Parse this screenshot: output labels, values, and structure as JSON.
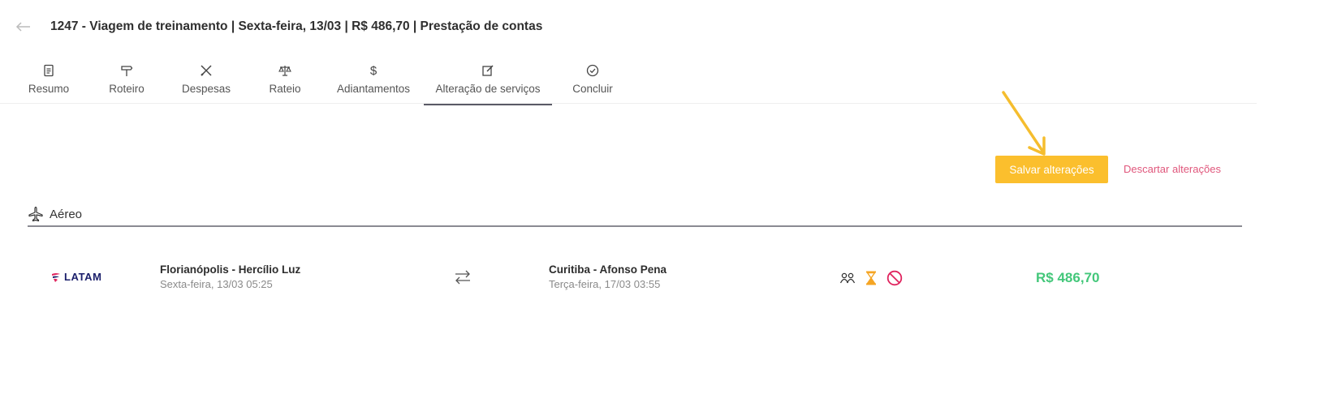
{
  "header": {
    "title": "1247 - Viagem de treinamento | Sexta-feira, 13/03 | R$ 486,70 | Prestação de contas",
    "back_icon": "arrow-left-icon"
  },
  "tabs": [
    {
      "label": "Resumo",
      "icon": "document-icon"
    },
    {
      "label": "Roteiro",
      "icon": "signpost-icon"
    },
    {
      "label": "Despesas",
      "icon": "cutlery-icon"
    },
    {
      "label": "Rateio",
      "icon": "scale-icon"
    },
    {
      "label": "Adiantamentos",
      "icon": "dollar-icon"
    },
    {
      "label": "Alteração de serviços",
      "icon": "edit-icon",
      "active": true
    },
    {
      "label": "Concluir",
      "icon": "check-circle-icon"
    }
  ],
  "actions": {
    "save_label": "Salvar alterações",
    "discard_label": "Descartar alterações"
  },
  "section": {
    "title": "Aéreo",
    "icon": "airplane-icon"
  },
  "flight": {
    "airline": "LATAM",
    "origin_name": "Florianópolis - Hercílio Luz",
    "origin_time": "Sexta-feira, 13/03 05:25",
    "destination_name": "Curitiba - Afonso Pena",
    "destination_time": "Terça-feira, 17/03 03:55",
    "price": "R$ 486,70",
    "status_icons": [
      "passengers-icon",
      "hourglass-icon",
      "blocked-icon"
    ]
  },
  "colors": {
    "accent": "#fbbf2d",
    "discard": "#e0577c",
    "price": "#43c77a",
    "annotation_arrow": "#f5bd2e"
  }
}
